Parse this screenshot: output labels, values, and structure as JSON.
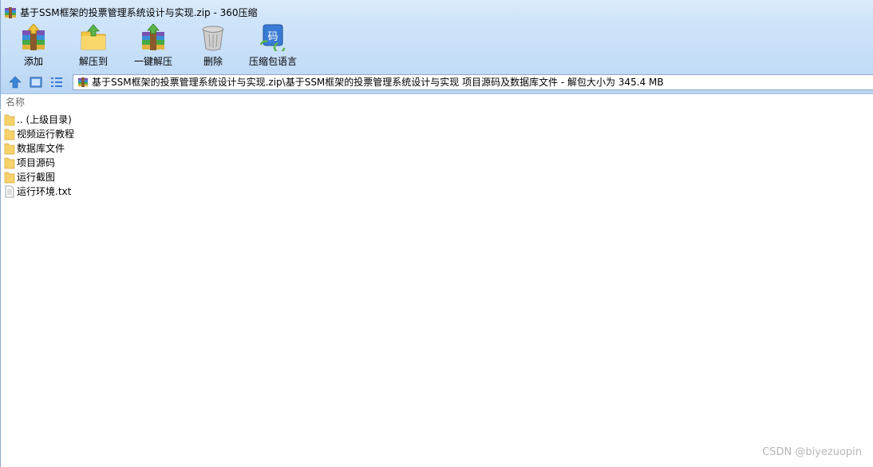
{
  "window": {
    "title": "基于SSM框架的投票管理系统设计与实现.zip - 360压缩"
  },
  "toolbar": {
    "add_label": "添加",
    "extract_to_label": "解压到",
    "one_click_extract_label": "一键解压",
    "delete_label": "删除",
    "language_label": "压缩包语言"
  },
  "address": {
    "path": "基于SSM框架的投票管理系统设计与实现.zip\\基于SSM框架的投票管理系统设计与实现  项目源码及数据库文件 - 解包大小为 345.4 MB"
  },
  "list": {
    "column_name": "名称",
    "items": [
      {
        "name": ".. (上级目录)",
        "type": "folder"
      },
      {
        "name": "视频运行教程",
        "type": "folder"
      },
      {
        "name": "数据库文件",
        "type": "folder"
      },
      {
        "name": "项目源码",
        "type": "folder"
      },
      {
        "name": "运行截图",
        "type": "folder"
      },
      {
        "name": "运行环境.txt",
        "type": "text-file"
      }
    ]
  },
  "watermark": "CSDN @biyezuopin",
  "colors": {
    "folder": "#f7d26b",
    "titlebar": "#dcebfb",
    "toolbar": "#c9e0f8",
    "accent_blue": "#3a7bd5"
  }
}
